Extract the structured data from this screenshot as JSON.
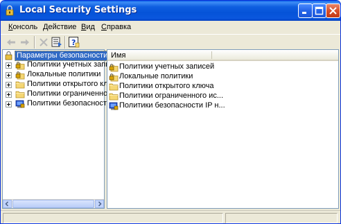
{
  "window": {
    "title": "Local Security Settings"
  },
  "menu": {
    "items": [
      {
        "label_rest": "онсоль",
        "mnemonic": "К"
      },
      {
        "label_rest": "ействие",
        "mnemonic": "Д"
      },
      {
        "label_rest": "ид",
        "mnemonic": "В"
      },
      {
        "label_rest": "правка",
        "mnemonic": "С"
      }
    ]
  },
  "toolbar": {
    "icons": [
      "back-arrow-icon",
      "forward-arrow-icon",
      "delete-icon",
      "export-list-icon",
      "help-icon"
    ]
  },
  "tree": {
    "root": "Параметры безопасности",
    "items": [
      {
        "label": "Политики учетных записе",
        "icon": "lock-folder-icon"
      },
      {
        "label": "Локальные политики",
        "icon": "lock-folder-icon"
      },
      {
        "label": "Политики открытого ключ",
        "icon": "folder-icon"
      },
      {
        "label": "Политики ограниченного",
        "icon": "folder-icon"
      },
      {
        "label": "Политики безопасности I",
        "icon": "ip-security-icon"
      }
    ]
  },
  "list": {
    "column_name": "Имя",
    "rows": [
      {
        "label": "Политики учетных записей",
        "icon": "lock-folder-icon"
      },
      {
        "label": "Локальные политики",
        "icon": "lock-folder-icon"
      },
      {
        "label": "Политики открытого ключа",
        "icon": "folder-icon"
      },
      {
        "label": "Политики ограниченного ис...",
        "icon": "folder-icon"
      },
      {
        "label": "Политики безопасности IP н...",
        "icon": "ip-security-icon"
      }
    ]
  },
  "colors": {
    "titlebar": "#0553d8",
    "selection": "#316ac5",
    "folder": "#f5d774"
  }
}
